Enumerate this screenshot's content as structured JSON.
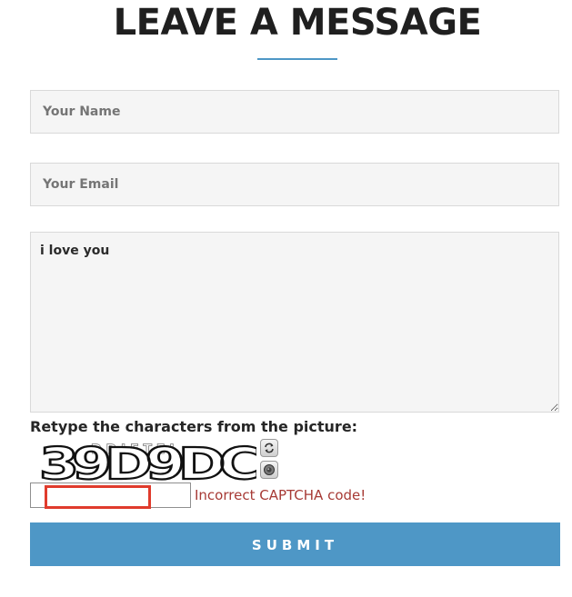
{
  "title": "LEAVE A MESSAGE",
  "form": {
    "name_placeholder": "Your Name",
    "name_value": "",
    "email_placeholder": "Your Email",
    "email_value": "",
    "message_value": "i love you",
    "captcha_prompt": "Retype the characters from the picture:",
    "captcha_text": "39D9DC",
    "captcha_value": "",
    "captcha_error": "Incorrect CAPTCHA code!",
    "submit_label": "SUBMIT"
  },
  "icons": {
    "refresh": "refresh-icon",
    "audio": "speaker-icon"
  },
  "colors": {
    "accent": "#4e97c6",
    "error": "#a73a35",
    "highlight": "#e03b2c"
  }
}
